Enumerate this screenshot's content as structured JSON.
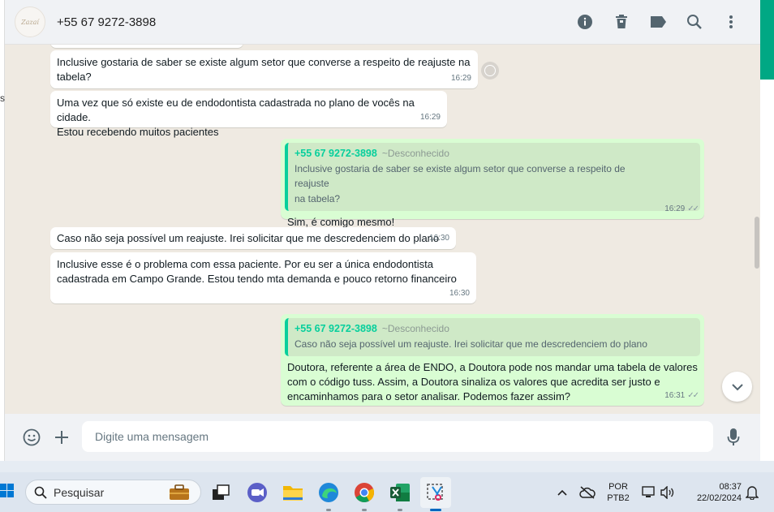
{
  "header": {
    "contact_name": "+55 67 9272-3898",
    "avatar_text": "Zazaí"
  },
  "messages": [
    {
      "type": "in",
      "text_lines": [
        "Inclusive gostaria de saber se existe algum setor que converse a respeito de reajuste na",
        "tabela?"
      ],
      "time": "16:29"
    },
    {
      "type": "in",
      "text_lines": [
        "Uma vez que só existe eu de endodontista cadastrada no plano de vocês na cidade.",
        "Estou recebendo muitos pacientes"
      ],
      "time": "16:29"
    },
    {
      "type": "out",
      "quote_name": "+55 67 9272-3898",
      "quote_tag": "~Desconhecido",
      "quote_lines": [
        "Inclusive gostaria de saber se existe algum setor que converse a respeito de reajuste",
        "na tabela?"
      ],
      "text_lines": [
        "Sim, é comigo mesmo!"
      ],
      "time": "16:29"
    },
    {
      "type": "in",
      "text_lines": [
        "Caso não seja possível um reajuste. Irei solicitar que me descredenciem do plano"
      ],
      "time": "16:30"
    },
    {
      "type": "in",
      "text_lines": [
        "Inclusive esse é o problema com essa paciente. Por eu ser a única endodontista",
        "cadastrada em Campo Grande. Estou tendo mta demanda e pouco retorno financeiro"
      ],
      "time": "16:30"
    },
    {
      "type": "out",
      "quote_name": "+55 67 9272-3898",
      "quote_tag": "~Desconhecido",
      "quote_lines": [
        "Caso não seja possível um reajuste. Irei solicitar que me descredenciem do plano"
      ],
      "text_lines": [
        "Doutora, referente a área de ENDO, a Doutora pode nos mandar uma tabela de valores",
        "com o código tuss. Assim, a Doutora sinaliza os valores que acredita ser justo e",
        "encaminhamos para o setor analisar. Podemos fazer assim?"
      ],
      "time": "16:31"
    }
  ],
  "compose": {
    "placeholder": "Digite uma mensagem"
  },
  "taskbar": {
    "search_label": "Pesquisar",
    "lang_top": "POR",
    "lang_bottom": "PTB2",
    "clock_time": "08:37",
    "clock_date": "22/02/2024"
  },
  "left_strip_char": "s",
  "colors": {
    "accent": "#00a884",
    "incoming": "#ffffff",
    "outgoing": "#d9fdd3",
    "quote_name": "#06cf9c"
  }
}
